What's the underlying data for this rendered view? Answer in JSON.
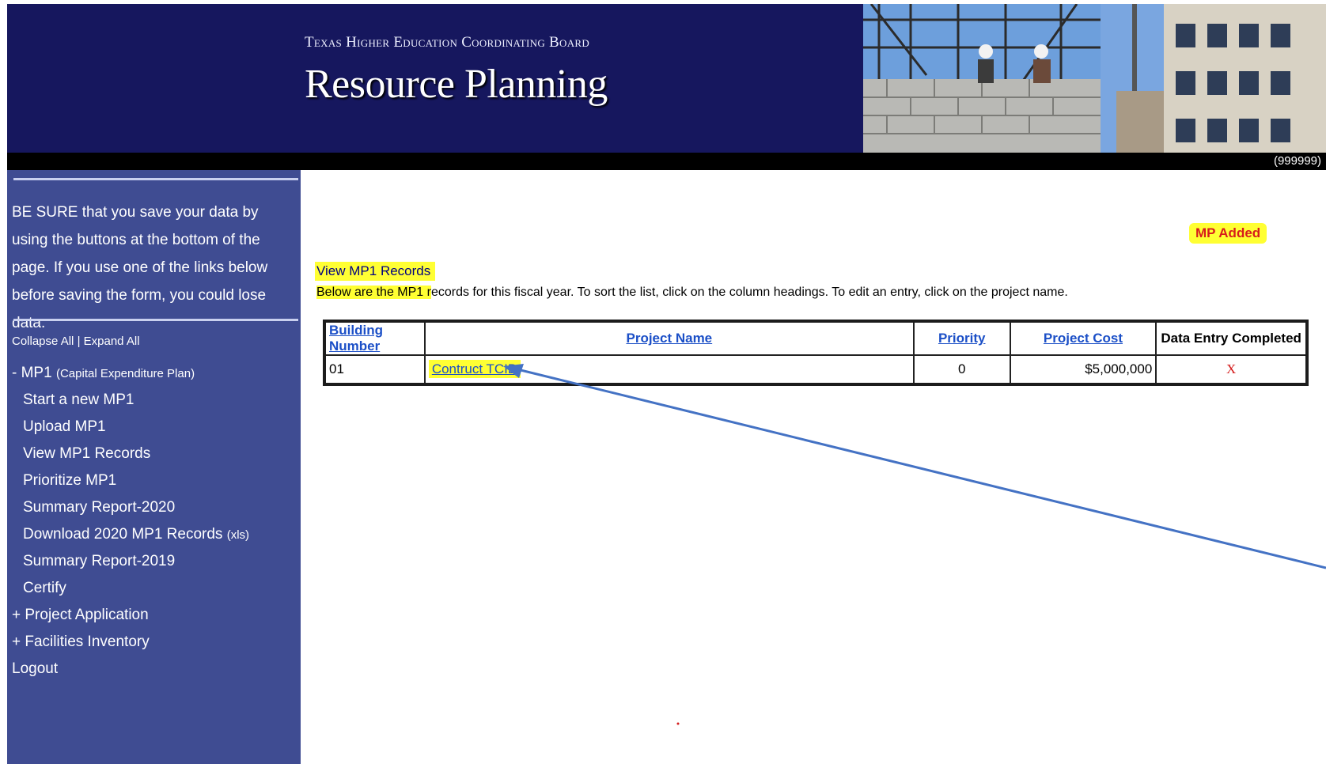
{
  "header": {
    "org_name": "Texas Higher Education Coordinating Board",
    "app_title": "Resource Planning",
    "user_id": "(999999)"
  },
  "sidebar": {
    "warning": "BE SURE that you save your data by using the buttons at the bottom of the page. If you use one of the links below before saving the form, you could lose data.",
    "collapse_all": "Collapse All",
    "separator": "|",
    "expand_all": "Expand All",
    "mp1_header": "- MP1",
    "mp1_sub": "(Capital Expenditure Plan)",
    "items": [
      {
        "label": "Start a new MP1"
      },
      {
        "label": "Upload MP1"
      },
      {
        "label": "View MP1 Records"
      },
      {
        "label": "Prioritize MP1"
      },
      {
        "label": "Summary Report-2020"
      },
      {
        "label": "Download 2020 MP1 Records",
        "suffix": "(xls)"
      },
      {
        "label": "Summary Report-2019"
      },
      {
        "label": "Certify"
      }
    ],
    "project_application": "+ Project Application",
    "facilities_inventory": "+ Facilities Inventory",
    "logout": "Logout"
  },
  "main": {
    "badge": "MP Added",
    "section_title": "View MP1 Records",
    "instructions_hl": "Below are the MP1 r",
    "instructions_rest": "ecords for this fiscal year. To sort the list, click on the column headings. To edit an entry, click on the project name.",
    "table": {
      "headers": [
        "Building Number",
        "Project Name",
        "Priority",
        "Project Cost",
        "Data Entry Completed"
      ],
      "rows": [
        {
          "building": "01",
          "project": "Contruct TCID",
          "priority": "0",
          "cost": "$5,000,000",
          "completed": "X"
        }
      ]
    }
  },
  "colors": {
    "banner": "#16175e",
    "sidebar": "#3f4c92",
    "highlight": "#ffff33",
    "link": "#1b4fc7",
    "annotation_arrow": "#4472c4",
    "incomplete_mark": "#d41c1c"
  }
}
